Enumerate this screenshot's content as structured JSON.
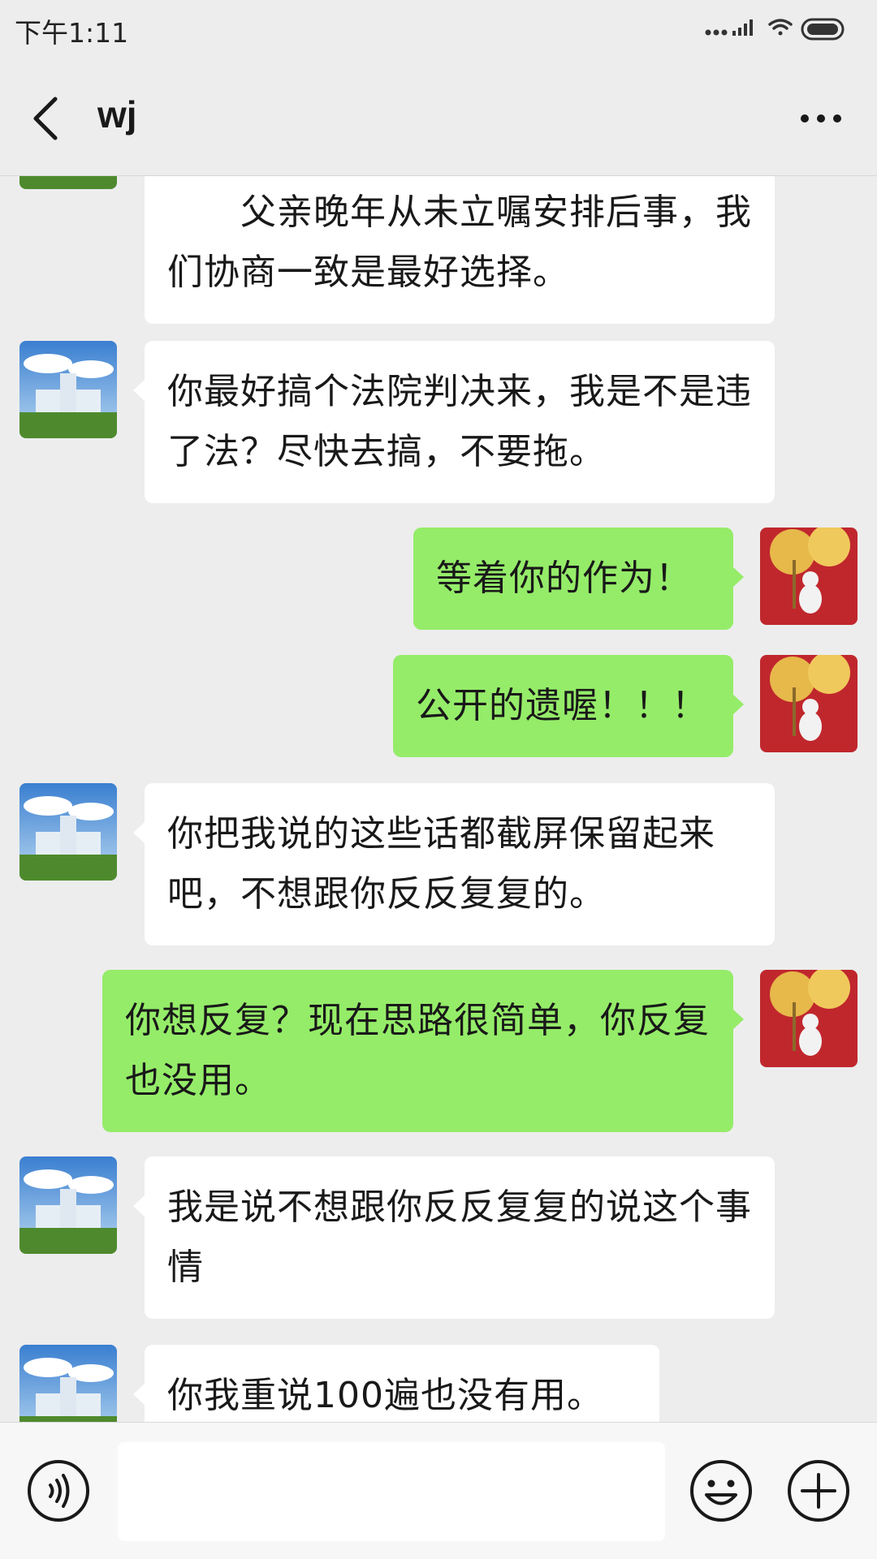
{
  "status_bar": {
    "time": "下午1:11"
  },
  "header": {
    "title": "wj"
  },
  "messages": [
    {
      "side": "in",
      "text": "　　父亲晚年从未立嘱安排后事，我们协商一致是最好选择。"
    },
    {
      "side": "in",
      "text": "你最好搞个法院判决来，我是不是违了法？尽快去搞，不要拖。"
    },
    {
      "side": "out",
      "text": "等着你的作为！"
    },
    {
      "side": "out",
      "text": "公开的遗喔！！！"
    },
    {
      "side": "in",
      "text": "你把我说的这些话都截屏保留起来吧，不想跟你反反复复的。"
    },
    {
      "side": "out",
      "text": "你想反复？现在思路很简单，你反复也没用。"
    },
    {
      "side": "in",
      "text": "我是说不想跟你反反复复的说这个事情"
    },
    {
      "side": "in",
      "text": "你我重说100遍也没有用。"
    }
  ],
  "input_bar": {
    "placeholder": ""
  },
  "colors": {
    "background": "#ededed",
    "outgoing_bubble": "#95ec69",
    "incoming_bubble": "#ffffff"
  },
  "icons": [
    "back-arrow-icon",
    "more-dots-icon",
    "voice-icon",
    "emoji-icon",
    "plus-icon",
    "signal-icon",
    "wifi-icon",
    "battery-icon"
  ]
}
